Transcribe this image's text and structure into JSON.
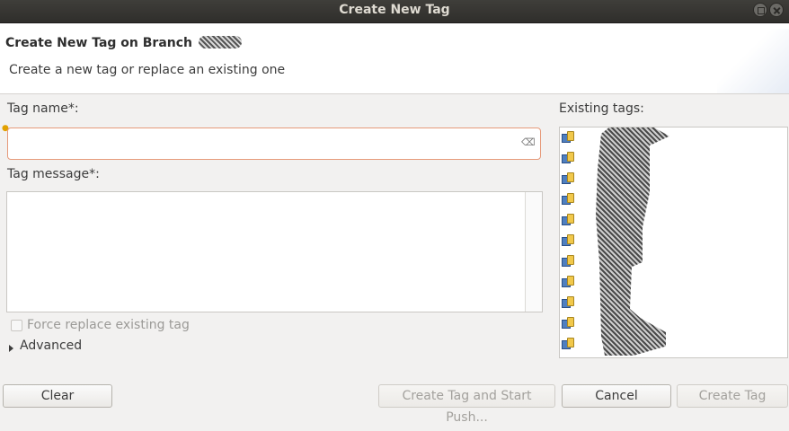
{
  "window": {
    "title": "Create New Tag"
  },
  "banner": {
    "title": "Create New Tag on Branch",
    "description": "Create a new tag or replace an existing one"
  },
  "form": {
    "tag_name_label": "Tag name*:",
    "tag_name_value": "",
    "tag_message_label": "Tag message*:",
    "tag_message_value": "",
    "force_replace_label": "Force replace existing tag",
    "force_replace_checked": false,
    "advanced_label": "Advanced"
  },
  "existing_tags": {
    "label": "Existing tags:",
    "items": [
      "",
      "",
      "",
      "",
      "",
      "",
      "",
      "",
      "",
      "",
      "",
      ""
    ]
  },
  "buttons": {
    "clear": "Clear",
    "create_and_push": "Create Tag and Start Push...",
    "cancel": "Cancel",
    "create": "Create Tag"
  }
}
